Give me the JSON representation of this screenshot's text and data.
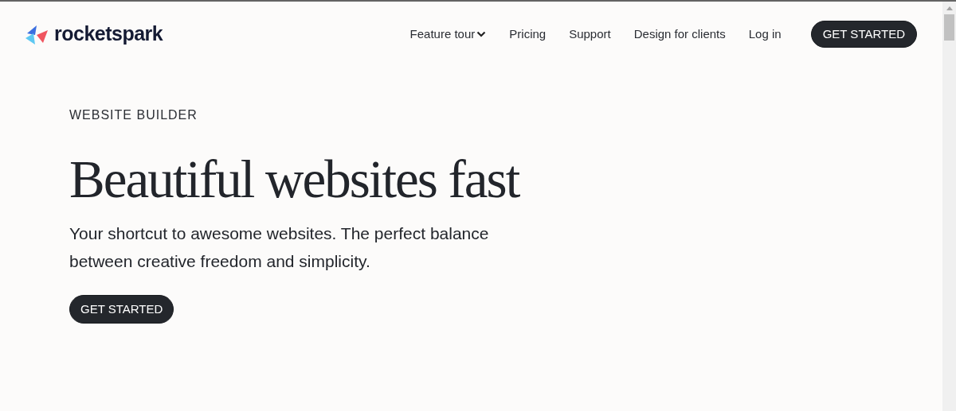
{
  "brand": {
    "name": "rocketspark"
  },
  "nav": {
    "items": [
      {
        "label": "Feature tour",
        "has_menu": true
      },
      {
        "label": "Pricing",
        "has_menu": false
      },
      {
        "label": "Support",
        "has_menu": false
      },
      {
        "label": "Design for clients",
        "has_menu": false
      },
      {
        "label": "Log in",
        "has_menu": false
      }
    ],
    "cta": "GET STARTED"
  },
  "hero": {
    "eyebrow": "WEBSITE BUILDER",
    "title": "Beautiful websites fast",
    "subtitle": "Your shortcut to awesome websites. The perfect balance between creative freedom and simplicity.",
    "cta": "GET STARTED"
  }
}
